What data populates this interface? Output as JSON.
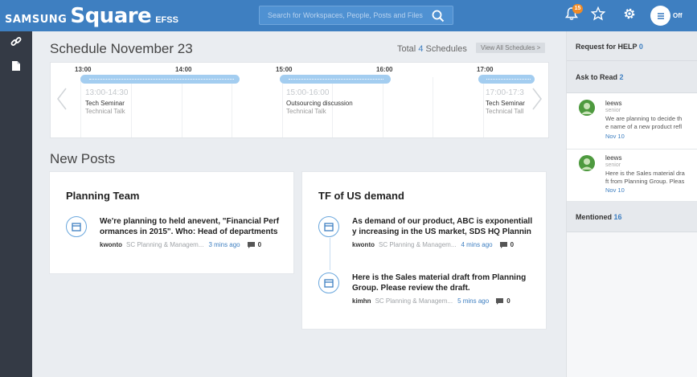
{
  "brand": {
    "samsung": "SAMSUNG",
    "square": "Square",
    "efss": "EFSS"
  },
  "search": {
    "placeholder": "Search for Workspaces, People, Posts and Files"
  },
  "topbar": {
    "notification_count": "15",
    "status": "Off"
  },
  "icons": {
    "nav": [
      "link-icon",
      "document-icon"
    ],
    "topbar": [
      "bell-icon",
      "star-icon",
      "gear-icon",
      "avatar-icon",
      "search-icon"
    ]
  },
  "schedule": {
    "title": "Schedule November 23",
    "total_prefix": "Total",
    "total_count": "4",
    "total_suffix": "Schedules",
    "view_all": "View All Schedules >",
    "times": [
      "13:00",
      "14:00",
      "15:00",
      "16:00",
      "17:00"
    ],
    "events": [
      {
        "range": "13:00-14:30",
        "name": "Tech Seminar",
        "category": "Technical Talk"
      },
      {
        "range": "15:00-16:00",
        "name": "Outsourcing discussion",
        "category": "Technical Talk"
      },
      {
        "range": "17:00-17:3",
        "name": "Tech Seminar",
        "category": "Technical Tall"
      }
    ]
  },
  "new_posts": {
    "title": "New Posts",
    "cards": [
      {
        "title": "Planning Team",
        "posts": [
          {
            "line1": "We're planning to held anevent, \"Financial Perf",
            "line2": "ormances in 2015\". Who: Head of departments",
            "author": "kwonto",
            "workspace": "SC Planning & Managem...",
            "time": "3 mins ago",
            "comments": "0"
          }
        ]
      },
      {
        "title": "TF of US demand",
        "posts": [
          {
            "line1": "As demand of our product, ABC is exponentiall",
            "line2": "y increasing in the US market, SDS HQ Plannin",
            "author": "kwonto",
            "workspace": "SC Planning & Managem...",
            "time": "4 mins ago",
            "comments": "0"
          },
          {
            "line1": "Here is the Sales material draft from Planning",
            "line2": "Group. Please review the draft.",
            "author": "kimhn",
            "workspace": "SC Planning & Managem...",
            "time": "5 mins ago",
            "comments": "0"
          }
        ]
      }
    ]
  },
  "right_panel": {
    "request_help": {
      "label": "Request for HELP",
      "count": "0"
    },
    "ask_to_read": {
      "label": "Ask to Read",
      "count": "2",
      "items": [
        {
          "user": "leews",
          "role": "senior",
          "line1": "We are planning to decide th",
          "line2": "e name of a new product refl",
          "date": "Nov 10"
        },
        {
          "user": "leews",
          "role": "senior",
          "line1": "Here is the Sales material dra",
          "line2": "ft from Planning Group. Pleas",
          "date": "Nov 10"
        }
      ]
    },
    "mentioned": {
      "label": "Mentioned",
      "count": "16"
    }
  },
  "colors": {
    "topbar": "#3e7fc1",
    "leftnav": "#343a45",
    "accent": "#3e7fc1",
    "timeline_bar": "#a3cdf0",
    "badge": "#f08a24"
  }
}
